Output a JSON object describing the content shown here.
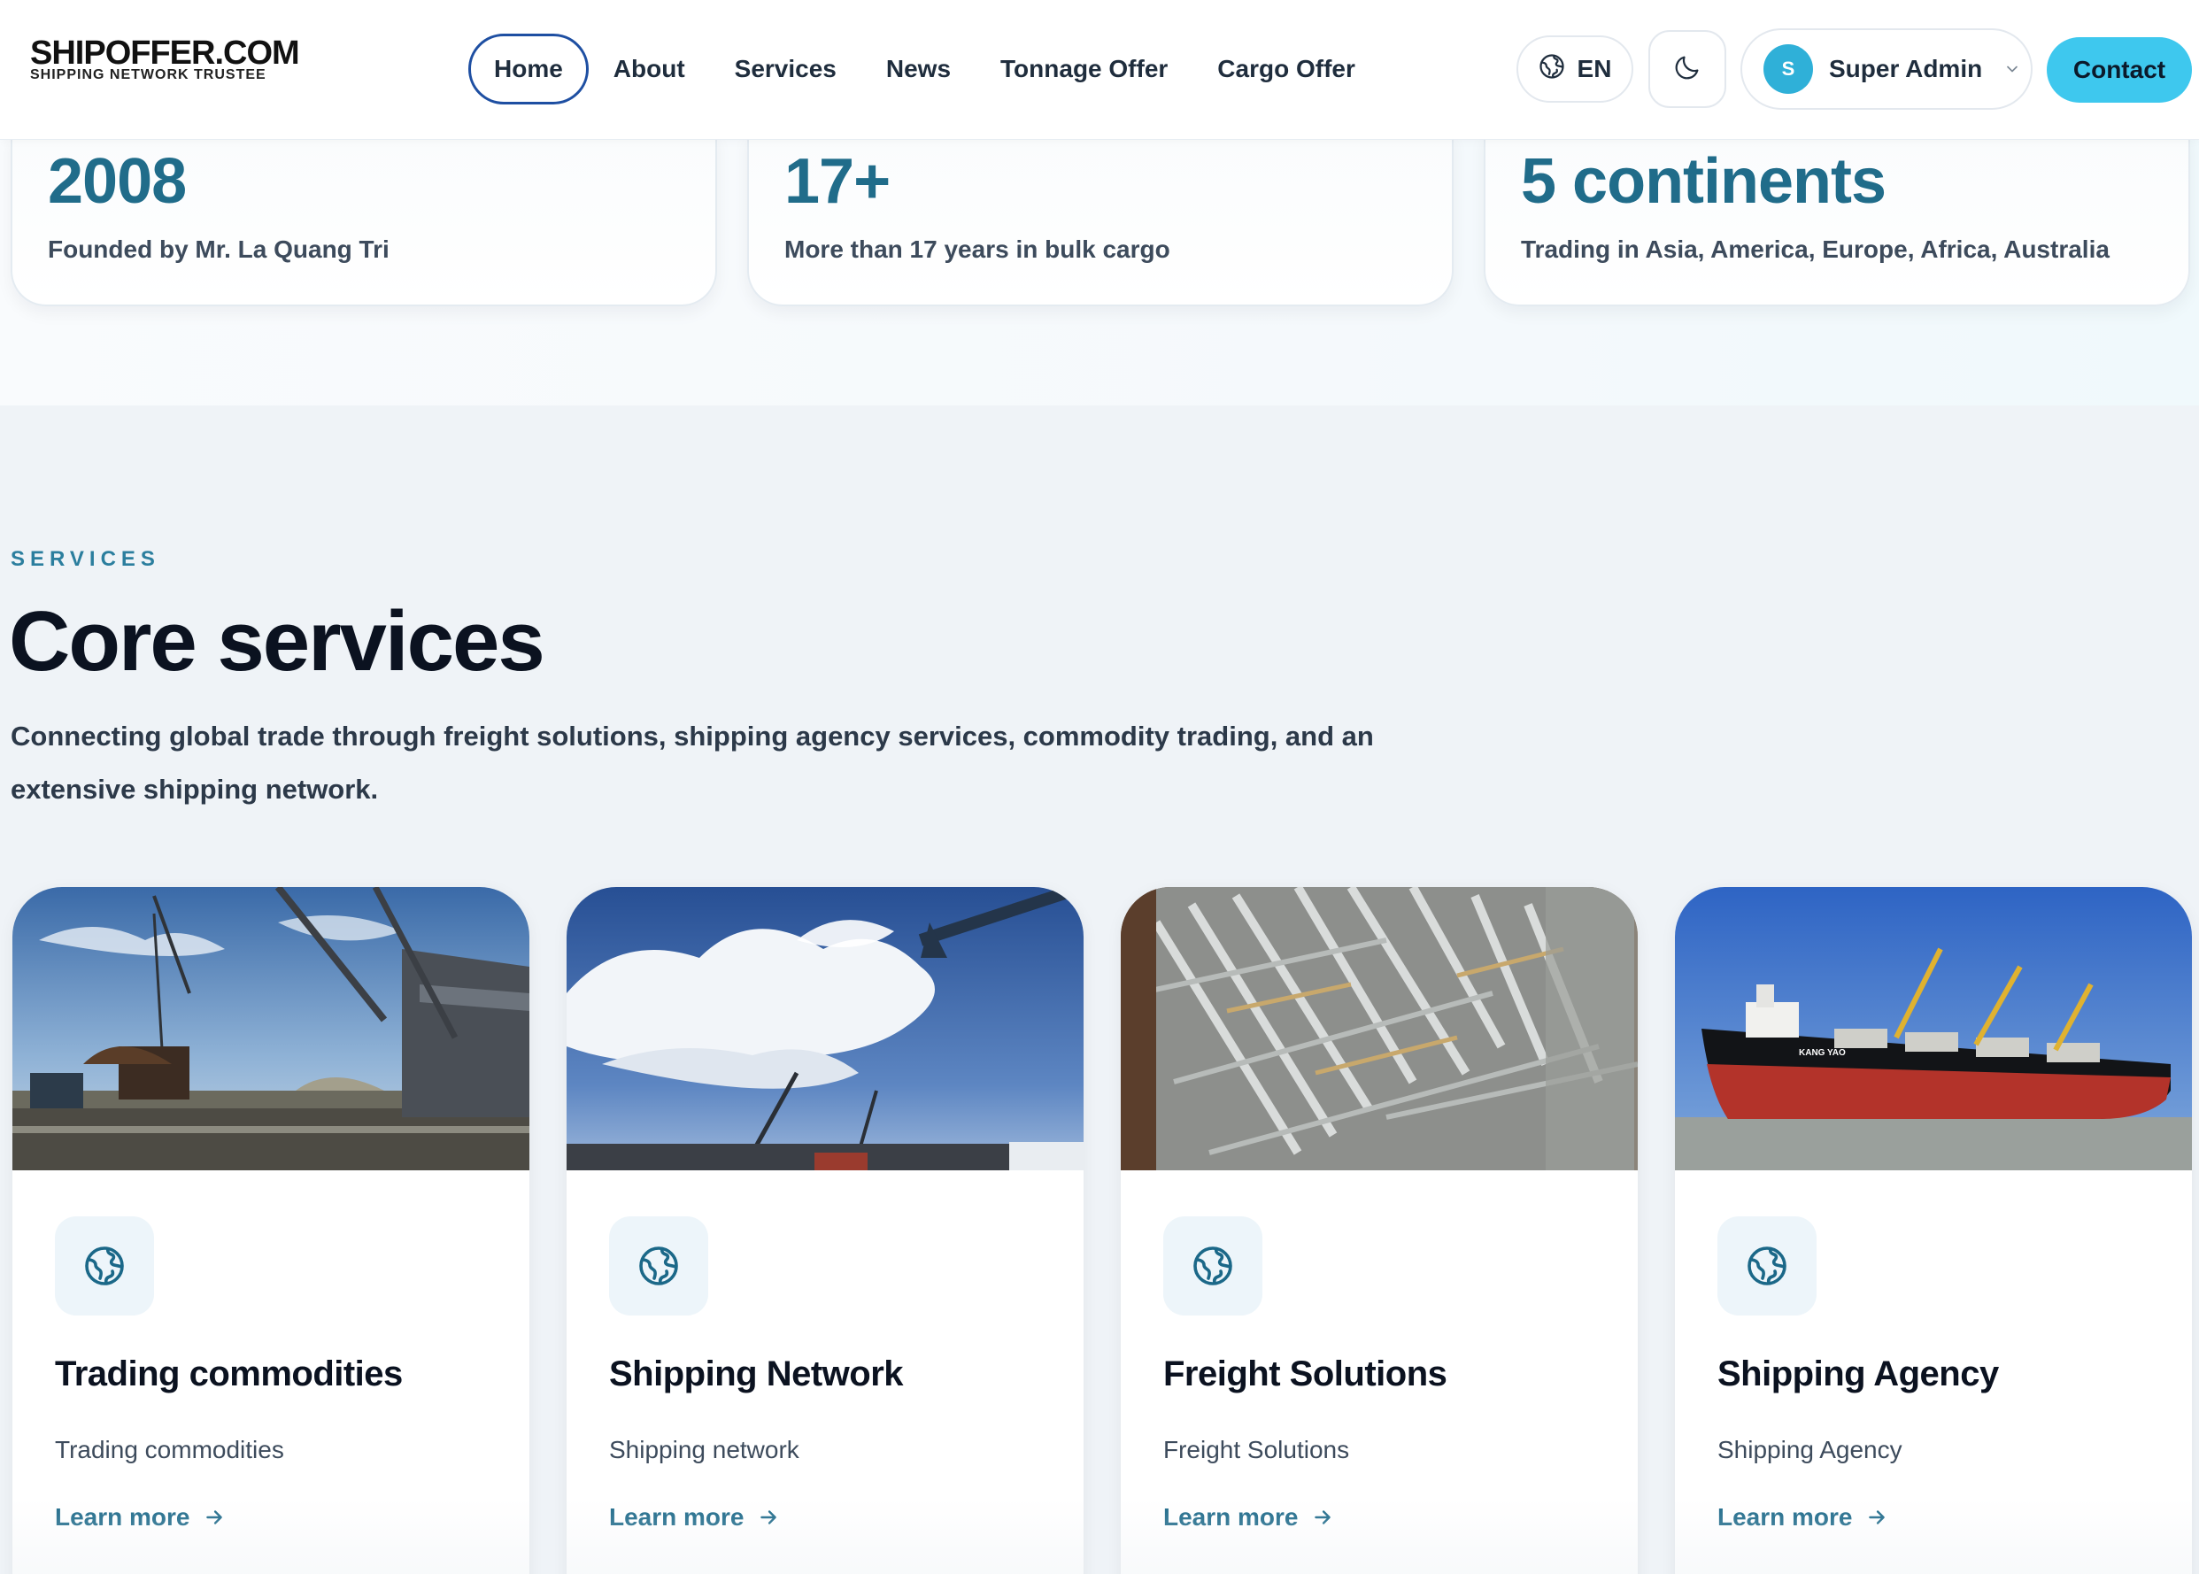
{
  "brand": {
    "name": "SHIPOFFER.COM",
    "tagline": "SHIPPING NETWORK TRUSTEE"
  },
  "nav": {
    "items": [
      {
        "label": "Home",
        "active": true
      },
      {
        "label": "About",
        "active": false
      },
      {
        "label": "Services",
        "active": false
      },
      {
        "label": "News",
        "active": false
      },
      {
        "label": "Tonnage Offer",
        "active": false
      },
      {
        "label": "Cargo Offer",
        "active": false
      }
    ]
  },
  "header": {
    "language": "EN",
    "language_icon": "globe-icon",
    "theme_icon": "moon-icon",
    "user": {
      "initial": "S",
      "name": "Super Admin"
    },
    "contact_label": "Contact"
  },
  "stats": [
    {
      "value": "2008",
      "label": "Founded by Mr. La Quang Tri"
    },
    {
      "value": "17+",
      "label": "More than 17 years in bulk cargo"
    },
    {
      "value": "5 continents",
      "label": "Trading in Asia, America, Europe, Africa, Australia"
    }
  ],
  "services": {
    "eyebrow": "SERVICES",
    "title": "Core services",
    "description": "Connecting global trade through freight solutions, shipping agency services, commodity trading, and an extensive shipping network.",
    "cards": [
      {
        "title": "Trading commodities",
        "description": "Trading commodities",
        "link": "Learn more",
        "icon": "globe-icon",
        "image": "port-crane-photo"
      },
      {
        "title": "Shipping Network",
        "description": "Shipping network",
        "link": "Learn more",
        "icon": "globe-icon",
        "image": "sky-crane-photo"
      },
      {
        "title": "Freight Solutions",
        "description": "Freight Solutions",
        "link": "Learn more",
        "icon": "globe-icon",
        "image": "steel-cargo-photo"
      },
      {
        "title": "Shipping Agency",
        "description": "Shipping Agency",
        "link": "Learn more",
        "icon": "globe-icon",
        "image": "bulk-carrier-photo"
      }
    ]
  },
  "colors": {
    "accent": "#206c8a",
    "contact_button": "#3ec8ee",
    "active_nav_border": "#1e4fa2",
    "avatar": "#2fb0d8"
  }
}
